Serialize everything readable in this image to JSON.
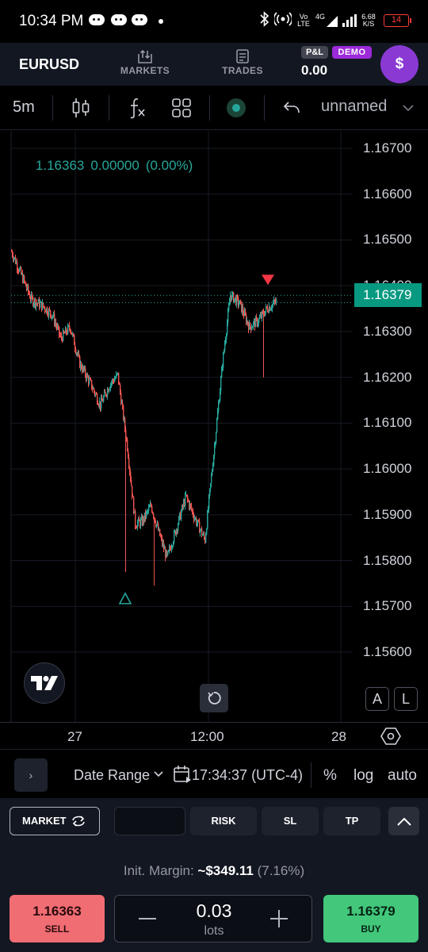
{
  "status_bar": {
    "time": "10:34 PM",
    "network_label_top": "Vo",
    "network_label_bottom": "LTE",
    "network_type": "4G",
    "speed_value": "6.68",
    "speed_unit": "K/S",
    "battery": "14"
  },
  "header": {
    "symbol": "EURUSD",
    "tabs": [
      {
        "label": "MARKETS",
        "icon": "markets-icon"
      },
      {
        "label": "TRADES",
        "icon": "trades-icon"
      }
    ],
    "pl_badge": "P&L",
    "demo_badge": "DEMO",
    "pl_value": "0.00",
    "account_symbol": "$",
    "accent_color": "#8a3ad3"
  },
  "toolbar": {
    "interval": "5m",
    "layout_name": "unnamed",
    "icons": [
      "candles-icon",
      "indicators-icon",
      "templates-icon",
      "alert-dot-icon",
      "undo-icon",
      "chevron-down-icon"
    ]
  },
  "chart": {
    "ohlc_readout": [
      "1.16363",
      "0.00000",
      "(0.00%)"
    ],
    "last_price": "1.16379",
    "y_labels": [
      "1.16700",
      "1.16600",
      "1.16500",
      "1.16400",
      "1.16300",
      "1.16200",
      "1.16100",
      "1.16000",
      "1.15900",
      "1.15800",
      "1.15700",
      "1.15600"
    ],
    "x_labels": [
      "27",
      "12:00",
      "28"
    ],
    "scale_buttons": [
      "A",
      "L"
    ],
    "up_color": "#26a69a",
    "down_color": "#ef5350"
  },
  "chart_data": {
    "type": "candlestick",
    "symbol": "EURUSD",
    "interval": "5m",
    "ylim": [
      1.15535,
      1.16745
    ],
    "y_ticks": [
      1.167,
      1.166,
      1.165,
      1.164,
      1.163,
      1.162,
      1.161,
      1.16,
      1.159,
      1.158,
      1.157,
      1.156
    ],
    "last_price": 1.16379,
    "bid_line": 1.16363,
    "trend": [
      [
        0,
        1.16475
      ],
      [
        12,
        1.16425
      ],
      [
        25,
        1.1637
      ],
      [
        40,
        1.16355
      ],
      [
        52,
        1.16335
      ],
      [
        62,
        1.16285
      ],
      [
        74,
        1.1631
      ],
      [
        86,
        1.1623
      ],
      [
        100,
        1.16185
      ],
      [
        112,
        1.1614
      ],
      [
        124,
        1.16185
      ],
      [
        134,
        1.16205
      ],
      [
        146,
        1.1605
      ],
      [
        156,
        1.1588
      ],
      [
        165,
        1.15885
      ],
      [
        176,
        1.1592
      ],
      [
        186,
        1.1586
      ],
      [
        196,
        1.15805
      ],
      [
        208,
        1.1587
      ],
      [
        220,
        1.1594
      ],
      [
        232,
        1.1589
      ],
      [
        244,
        1.15845
      ],
      [
        256,
        1.1605
      ],
      [
        266,
        1.1623
      ],
      [
        276,
        1.1638
      ],
      [
        288,
        1.1636
      ],
      [
        300,
        1.1631
      ],
      [
        312,
        1.16325
      ],
      [
        322,
        1.1635
      ],
      [
        334,
        1.16365
      ]
    ],
    "markers": [
      {
        "type": "sell",
        "bar": 324,
        "price": 1.16412
      },
      {
        "type": "buy",
        "bar": 144,
        "price": 1.15718
      }
    ],
    "wick_extremes": [
      {
        "bar": 144,
        "low": 1.15775
      },
      {
        "bar": 180,
        "low": 1.15745
      },
      {
        "bar": 318,
        "low": 1.162
      }
    ]
  },
  "bottom_bar": {
    "expand_label": "›",
    "date_range": "Date Range",
    "clock": "17:34:37 (UTC-4)",
    "options": [
      "%",
      "log",
      "auto"
    ]
  },
  "order_panel": {
    "order_type": "MARKET",
    "tabs": [
      "RISK",
      "SL",
      "TP"
    ],
    "margin_label": "Init. Margin:",
    "margin_value": "~$349.11",
    "margin_pct": "(7.16%)",
    "sell_price": "1.16363",
    "sell_label": "SELL",
    "buy_price": "1.16379",
    "buy_label": "BUY",
    "lots_value": "0.03",
    "lots_label": "lots",
    "sell_color": "#f06d73",
    "buy_color": "#42c77b"
  }
}
